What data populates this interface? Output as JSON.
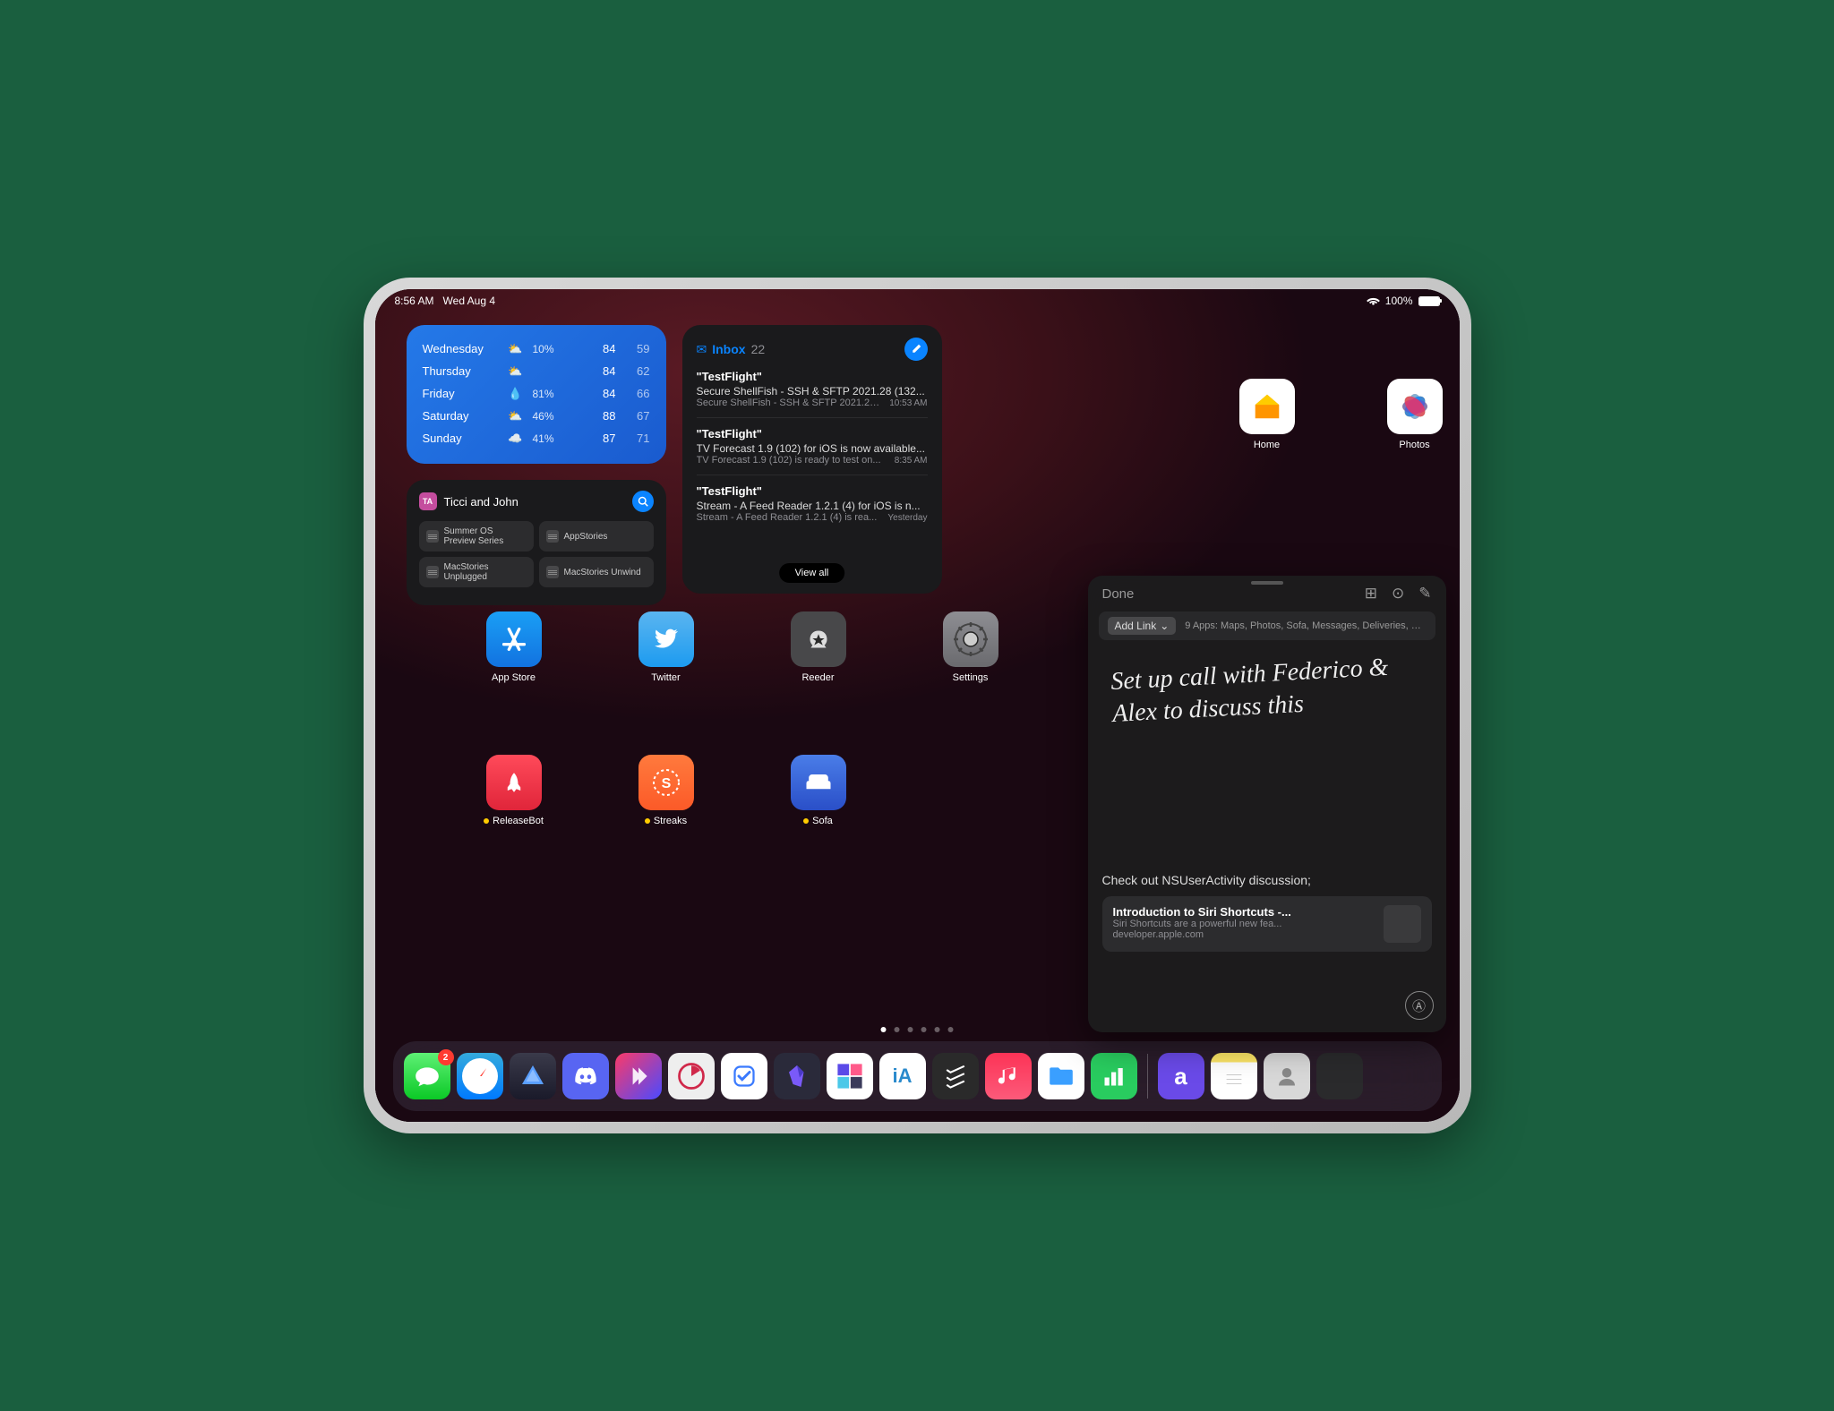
{
  "status": {
    "time": "8:56 AM",
    "date": "Wed Aug 4",
    "battery_pct": "100%"
  },
  "weather": {
    "rows": [
      {
        "day": "Wednesday",
        "icon": "⛅",
        "pct": "10%",
        "hi": "84",
        "lo": "59"
      },
      {
        "day": "Thursday",
        "icon": "⛅",
        "pct": "",
        "hi": "84",
        "lo": "62"
      },
      {
        "day": "Friday",
        "icon": "💧",
        "pct": "81%",
        "hi": "84",
        "lo": "66"
      },
      {
        "day": "Saturday",
        "icon": "⛅",
        "pct": "46%",
        "hi": "88",
        "lo": "67"
      },
      {
        "day": "Sunday",
        "icon": "☁️",
        "pct": "41%",
        "hi": "87",
        "lo": "71"
      }
    ]
  },
  "notes_widget": {
    "avatar": "TA",
    "title": "Ticci and John",
    "items": [
      "Summer OS Preview Series",
      "AppStories",
      "MacStories Unplugged",
      "MacStories Unwind"
    ]
  },
  "mail": {
    "title": "Inbox",
    "count": "22",
    "viewall": "View all",
    "items": [
      {
        "from": "\"TestFlight\"",
        "subject": "Secure ShellFish - SSH & SFTP 2021.28 (132...",
        "preview": "Secure ShellFish - SSH & SFTP 2021.28...",
        "time": "10:53 AM"
      },
      {
        "from": "\"TestFlight\"",
        "subject": "TV Forecast 1.9 (102) for iOS is now available...",
        "preview": "TV Forecast 1.9 (102) is ready to test on...",
        "time": "8:35 AM"
      },
      {
        "from": "\"TestFlight\"",
        "subject": "Stream - A Feed Reader 1.2.1 (4) for iOS is n...",
        "preview": "Stream - A Feed Reader 1.2.1 (4) is rea...",
        "time": "Yesterday"
      }
    ]
  },
  "apps_right": [
    {
      "label": "Home"
    },
    {
      "label": "Photos"
    }
  ],
  "apps_row2": [
    {
      "label": "App Store"
    },
    {
      "label": "Twitter"
    },
    {
      "label": "Reeder"
    },
    {
      "label": "Settings"
    }
  ],
  "apps_row3": [
    {
      "label": "ReleaseBot",
      "dot": true
    },
    {
      "label": "Streaks",
      "dot": true
    },
    {
      "label": "Sofa",
      "dot": true
    }
  ],
  "dock_badge": "2",
  "quicknote": {
    "done": "Done",
    "addlink": "Add Link",
    "apps": "9 Apps: Maps, Photos, Sofa, Messages, Deliveries, Me...",
    "handwriting": "Set up call with Federico & Alex to discuss this",
    "text": "Check out NSUserActivity discussion;",
    "link_title": "Introduction to Siri Shortcuts -...",
    "link_desc": "Siri Shortcuts are a powerful new fea...",
    "link_url": "developer.apple.com"
  }
}
